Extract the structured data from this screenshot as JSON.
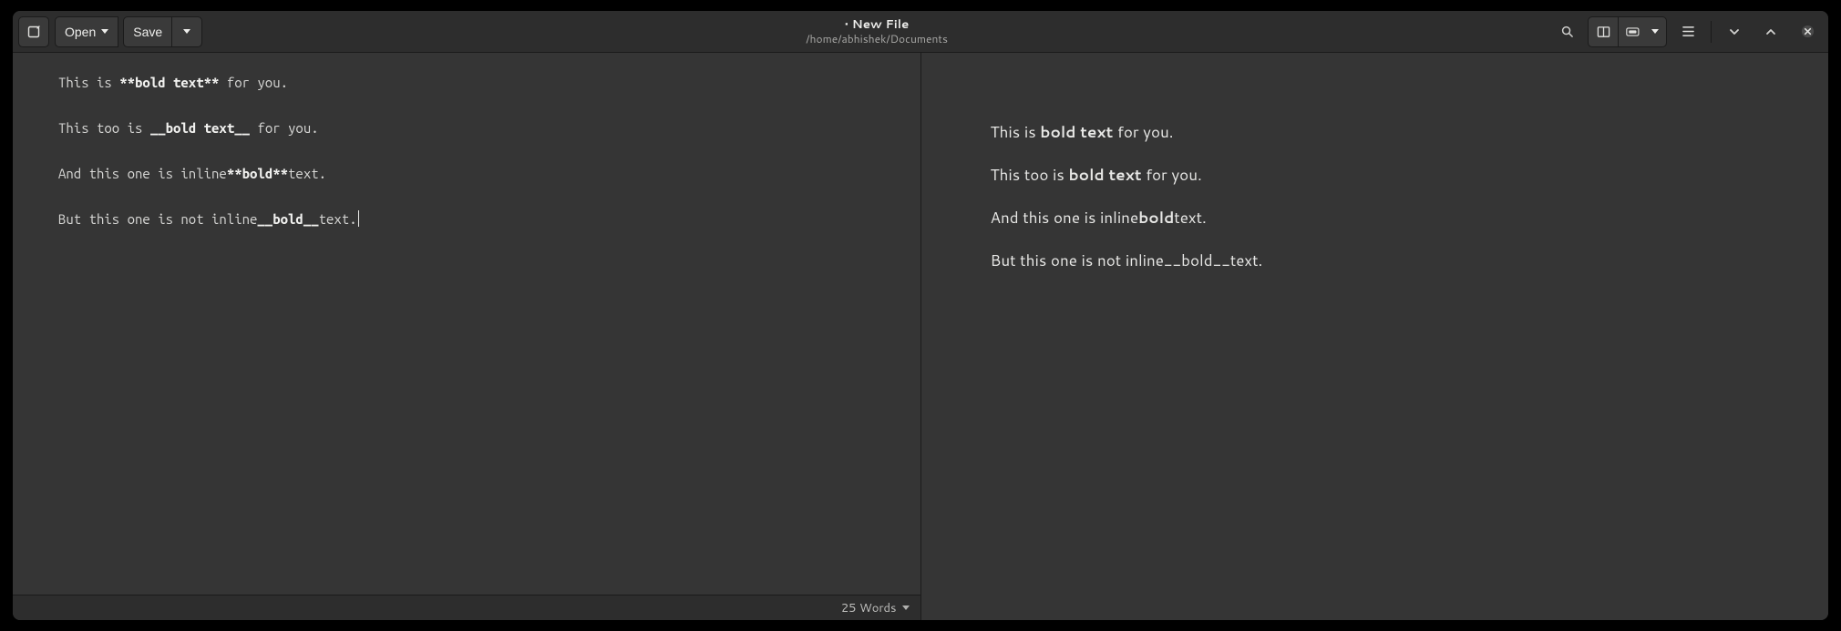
{
  "header": {
    "title": "• New File",
    "path": "/home/abhishek/Documents",
    "open_label": "Open",
    "save_label": "Save"
  },
  "icons": {
    "new_tab": "new-tab-icon",
    "search": "search-icon",
    "split_layout": "split-layout-icon",
    "toolbar": "toolbar-icon",
    "hamburger": "hamburger-icon",
    "chevron_down": "chevron-down-icon",
    "chevron_up": "chevron-up-icon",
    "close": "close-icon"
  },
  "editor": {
    "lines": [
      {
        "segments": [
          {
            "t": "This is "
          },
          {
            "t": "**bold text**",
            "bold": true
          },
          {
            "t": " for you."
          }
        ]
      },
      {
        "segments": []
      },
      {
        "segments": [
          {
            "t": "This too is "
          },
          {
            "t": "__bold text__",
            "bold": true
          },
          {
            "t": " for you."
          }
        ]
      },
      {
        "segments": []
      },
      {
        "segments": [
          {
            "t": "And this one is inline"
          },
          {
            "t": "**bold**",
            "bold": true
          },
          {
            "t": "text."
          }
        ]
      },
      {
        "segments": []
      },
      {
        "segments": [
          {
            "t": "But this one is not inline"
          },
          {
            "t": "__bold__",
            "bold": true
          },
          {
            "t": "text."
          }
        ],
        "cursor_after": true
      }
    ]
  },
  "preview": {
    "paragraphs": [
      [
        {
          "t": "This is "
        },
        {
          "t": "bold text",
          "bold": true
        },
        {
          "t": " for you."
        }
      ],
      [
        {
          "t": "This too is "
        },
        {
          "t": "bold text",
          "bold": true
        },
        {
          "t": " for you."
        }
      ],
      [
        {
          "t": "And this one is inline"
        },
        {
          "t": "bold",
          "bold": true
        },
        {
          "t": "text."
        }
      ],
      [
        {
          "t": "But this one is not inline__bold__text."
        }
      ]
    ]
  },
  "status": {
    "word_count_label": "25 Words"
  }
}
